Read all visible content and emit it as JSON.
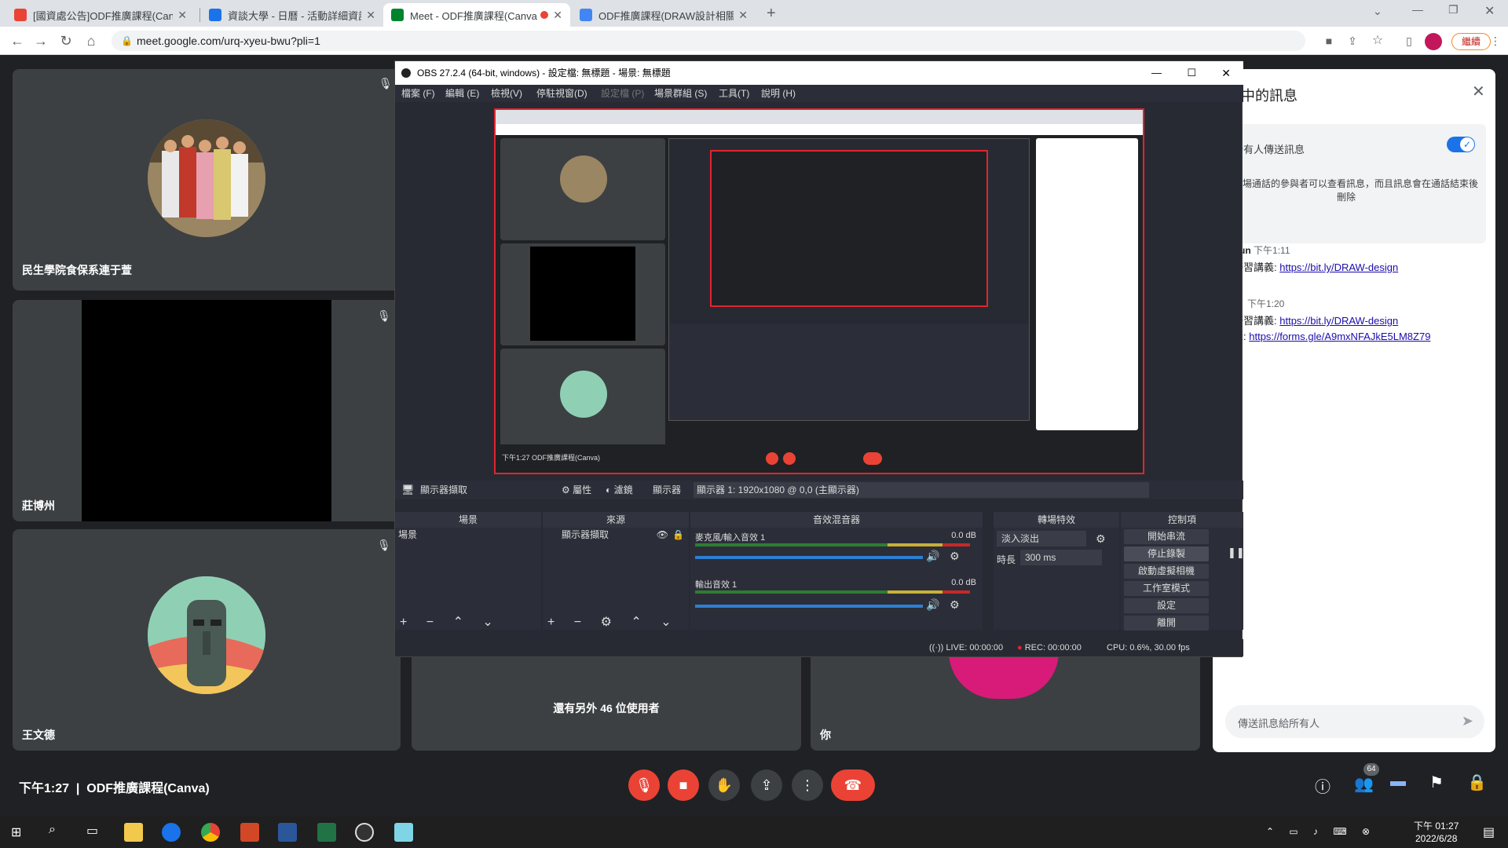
{
  "browser": {
    "tabs": [
      {
        "title": "[國資處公告]ODF推廣課程(Canv",
        "fav_color": "#ea4335"
      },
      {
        "title": "資談大學 - 日曆 - 活動詳細資訊",
        "fav_color": "#1a73e8"
      },
      {
        "title": "Meet - ODF推廣課程(Canva)",
        "fav_color": "#00832d"
      },
      {
        "title": "ODF推廣課程(DRAW設計相關產",
        "fav_color": "#4285f4"
      }
    ],
    "url": "meet.google.com/urq-xyeu-bwu?pli=1",
    "profile_btn": "繼續",
    "new_tab": "+"
  },
  "meet": {
    "participants": [
      {
        "name": "民生學院食保系連于萱"
      },
      {
        "name": "莊博州"
      },
      {
        "name": "王文德"
      }
    ],
    "others_text": "還有另外 46 位使用者",
    "self_label": "你",
    "time": "下午1:27",
    "meeting_name": "ODF推廣課程(Canva)",
    "people_count": "64"
  },
  "chat": {
    "title": "通話中的訊息",
    "toggle_label": "允許所有人傳送訊息",
    "notice": "只有這場通話的參與者可以查看訊息，而且訊息會在通話結束後刪除",
    "messages": [
      {
        "sender": "Eric Sun",
        "time": "下午1:11",
        "lines": [
          {
            "prefix": "今日研習講義: ",
            "link": "https://bit.ly/DRAW-design"
          }
        ]
      },
      {
        "sender": "",
        "time": "下午1:20",
        "lines": [
          {
            "prefix": "今日研習講義: ",
            "link": "https://bit.ly/DRAW-design"
          },
          {
            "prefix": "報到表: ",
            "link": "https://forms.gle/A9mxNFAJkE5LM8Z79"
          }
        ]
      }
    ],
    "input_placeholder": "傳送訊息給所有人"
  },
  "obs": {
    "title": "OBS 27.2.4 (64-bit, windows) - 設定檔: 無標題 - 場景: 無標題",
    "menu": [
      "檔案 (F)",
      "編輯 (E)",
      "檢視(V)",
      "停駐視窗(D)",
      "設定檔 (P)",
      "場景群組 (S)",
      "工具(T)",
      "說明 (H)"
    ],
    "source_bar": {
      "source": "顯示器擷取",
      "props": "屬性",
      "filters": "濾鏡",
      "display_label": "顯示器",
      "display_value": "顯示器 1: 1920x1080 @ 0,0 (主顯示器)"
    },
    "docks": {
      "scenes": {
        "header": "場景",
        "item": "場景"
      },
      "sources": {
        "header": "來源",
        "item": "顯示器擷取"
      },
      "mixer": {
        "header": "音效混音器",
        "tracks": [
          {
            "name": "麥克風/輸入音效 1",
            "db": "0.0 dB"
          },
          {
            "name": "輸出音效 1",
            "db": "0.0 dB"
          }
        ]
      },
      "transitions": {
        "header": "轉場特效",
        "type": "淡入淡出",
        "duration_label": "時長",
        "duration": "300 ms"
      },
      "controls": {
        "header": "控制項",
        "buttons": [
          "開始串流",
          "停止錄製",
          "啟動虛擬相機",
          "工作室模式",
          "設定",
          "離開"
        ]
      }
    },
    "status": {
      "live": "LIVE: 00:00:00",
      "rec": "REC: 00:00:00",
      "cpu": "CPU: 0.6%, 30.00 fps"
    },
    "preview_caption": "下午1:27   ODF推廣課程(Canva)"
  },
  "taskbar": {
    "time": "下午 01:27",
    "date": "2022/6/28"
  }
}
